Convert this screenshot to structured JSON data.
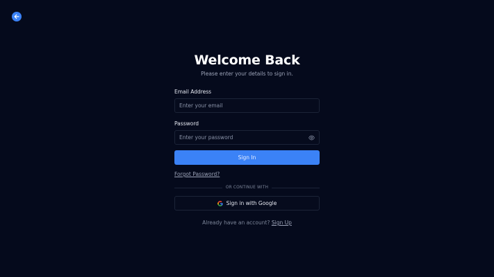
{
  "back": {
    "icon": "arrow-left-icon",
    "color": "#3b82f6"
  },
  "header": {
    "title": "Welcome Back",
    "subtitle": "Please enter your details to sign in."
  },
  "email": {
    "label": "Email Address",
    "placeholder": "Enter your email",
    "value": ""
  },
  "password": {
    "label": "Password",
    "placeholder": "Enter your password",
    "value": "",
    "toggle_icon": "eye-icon"
  },
  "signin": {
    "label": "Sign In",
    "color": "#3b82f6"
  },
  "forgot": {
    "label": "Forgot Password?"
  },
  "divider": {
    "label": "OR CONTINUE WITH"
  },
  "google": {
    "label": "Sign in with Google",
    "icon": "google-icon"
  },
  "signup": {
    "prompt": "Already have an account?",
    "link": "Sign Up"
  },
  "colors": {
    "background": "#050a1c",
    "accent": "#3b82f6"
  }
}
